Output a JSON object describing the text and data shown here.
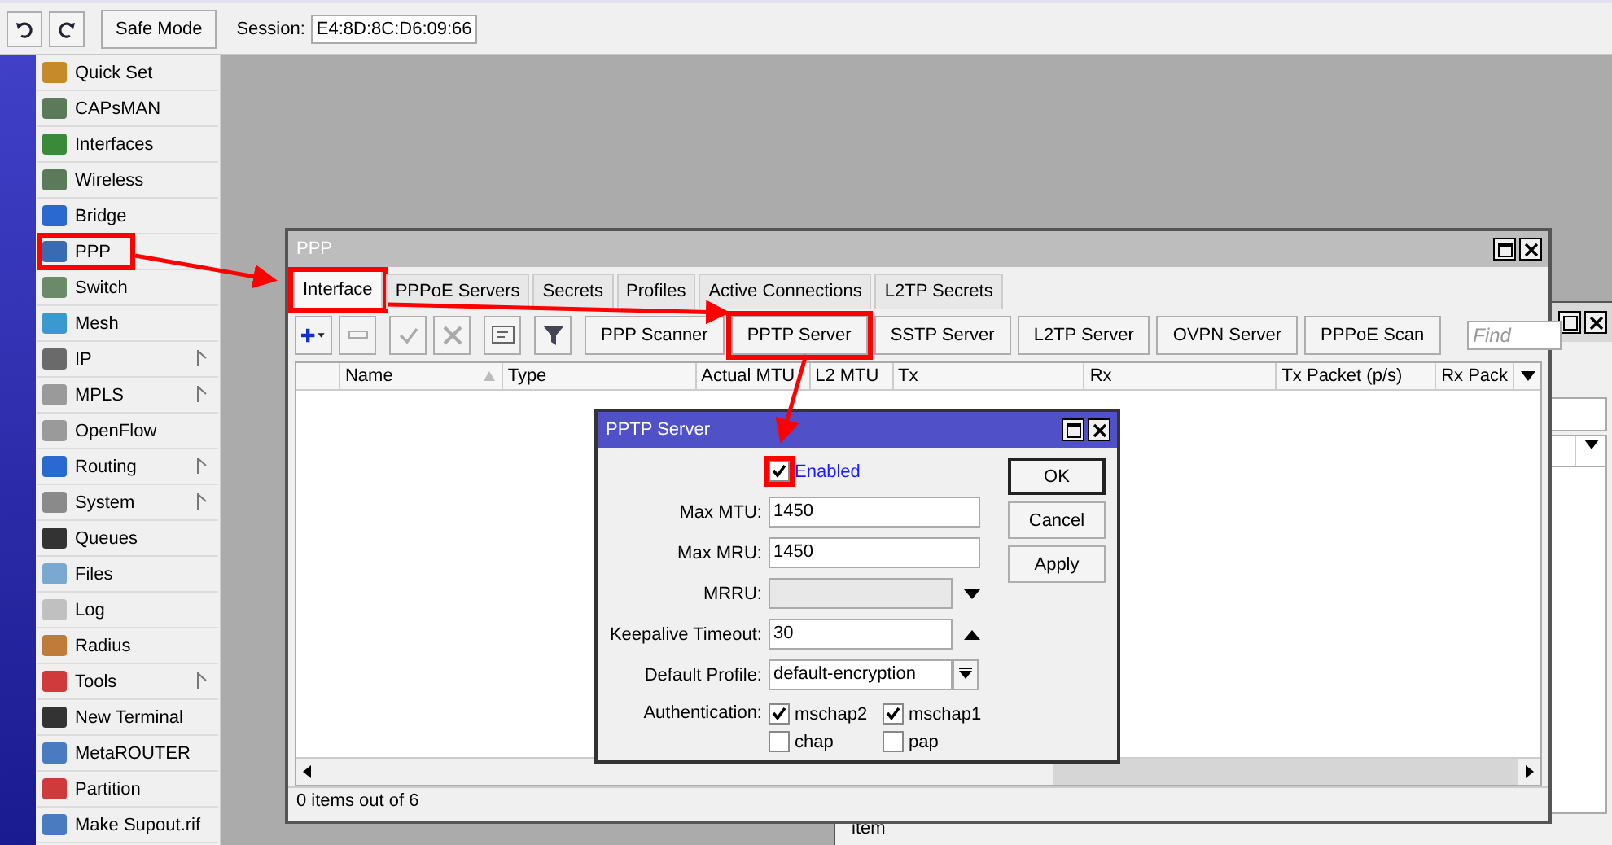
{
  "toolbar": {
    "safe_mode": "Safe Mode",
    "session_label": "Session:",
    "session_value": "E4:8D:8C:D6:09:66"
  },
  "menu": [
    {
      "label": "Quick Set",
      "submenu": false,
      "highlighted": false
    },
    {
      "label": "CAPsMAN",
      "submenu": false,
      "highlighted": false
    },
    {
      "label": "Interfaces",
      "submenu": false,
      "highlighted": false
    },
    {
      "label": "Wireless",
      "submenu": false,
      "highlighted": false
    },
    {
      "label": "Bridge",
      "submenu": false,
      "highlighted": false
    },
    {
      "label": "PPP",
      "submenu": false,
      "highlighted": true
    },
    {
      "label": "Switch",
      "submenu": false,
      "highlighted": false
    },
    {
      "label": "Mesh",
      "submenu": false,
      "highlighted": false
    },
    {
      "label": "IP",
      "submenu": true,
      "highlighted": false
    },
    {
      "label": "MPLS",
      "submenu": true,
      "highlighted": false
    },
    {
      "label": "OpenFlow",
      "submenu": false,
      "highlighted": false
    },
    {
      "label": "Routing",
      "submenu": true,
      "highlighted": false
    },
    {
      "label": "System",
      "submenu": true,
      "highlighted": false
    },
    {
      "label": "Queues",
      "submenu": false,
      "highlighted": false
    },
    {
      "label": "Files",
      "submenu": false,
      "highlighted": false
    },
    {
      "label": "Log",
      "submenu": false,
      "highlighted": false
    },
    {
      "label": "Radius",
      "submenu": false,
      "highlighted": false
    },
    {
      "label": "Tools",
      "submenu": true,
      "highlighted": false
    },
    {
      "label": "New Terminal",
      "submenu": false,
      "highlighted": false
    },
    {
      "label": "MetaROUTER",
      "submenu": false,
      "highlighted": false
    },
    {
      "label": "Partition",
      "submenu": false,
      "highlighted": false
    },
    {
      "label": "Make Supout.rif",
      "submenu": false,
      "highlighted": false
    }
  ],
  "back_window": {
    "status": "item"
  },
  "ppp_window": {
    "title": "PPP",
    "tabs": [
      {
        "label": "Interface",
        "selected": true,
        "highlighted": true
      },
      {
        "label": "PPPoE Servers",
        "selected": false,
        "highlighted": false
      },
      {
        "label": "Secrets",
        "selected": false,
        "highlighted": false
      },
      {
        "label": "Profiles",
        "selected": false,
        "highlighted": false
      },
      {
        "label": "Active Connections",
        "selected": false,
        "highlighted": false
      },
      {
        "label": "L2TP Secrets",
        "selected": false,
        "highlighted": false
      }
    ],
    "buttons": [
      {
        "label": "PPP Scanner",
        "highlighted": false
      },
      {
        "label": "PPTP Server",
        "highlighted": true
      },
      {
        "label": "SSTP Server",
        "highlighted": false
      },
      {
        "label": "L2TP Server",
        "highlighted": false
      },
      {
        "label": "OVPN Server",
        "highlighted": false
      },
      {
        "label": "PPPoE Scan",
        "highlighted": false
      }
    ],
    "find": {
      "placeholder": "Find"
    },
    "columns": [
      "Name",
      "Type",
      "Actual MTU",
      "L2 MTU",
      "Tx",
      "Rx",
      "Tx Packet (p/s)",
      "Rx Pack"
    ],
    "status": "0 items out of 6"
  },
  "dialog": {
    "title": "PPTP Server",
    "enabled": {
      "label": "Enabled",
      "checked": true,
      "highlighted": true
    },
    "fields": [
      {
        "label": "Max MTU:",
        "value": "1450",
        "kind": "text",
        "disabled": false
      },
      {
        "label": "Max MRU:",
        "value": "1450",
        "kind": "text",
        "disabled": false
      },
      {
        "label": "MRRU:",
        "kind": "down",
        "disabled": true
      },
      {
        "label": "Keepalive Timeout:",
        "value": "30",
        "kind": "up",
        "disabled": false
      },
      {
        "label": "Default Profile:",
        "value": "default-encryption",
        "kind": "select",
        "disabled": false
      }
    ],
    "auth_label": "Authentication:",
    "auth": [
      {
        "label": "mschap2",
        "checked": true
      },
      {
        "label": "mschap1",
        "checked": true
      },
      {
        "label": "chap",
        "checked": false
      },
      {
        "label": "pap",
        "checked": false
      }
    ],
    "buttons": [
      "OK",
      "Cancel",
      "Apply"
    ]
  }
}
